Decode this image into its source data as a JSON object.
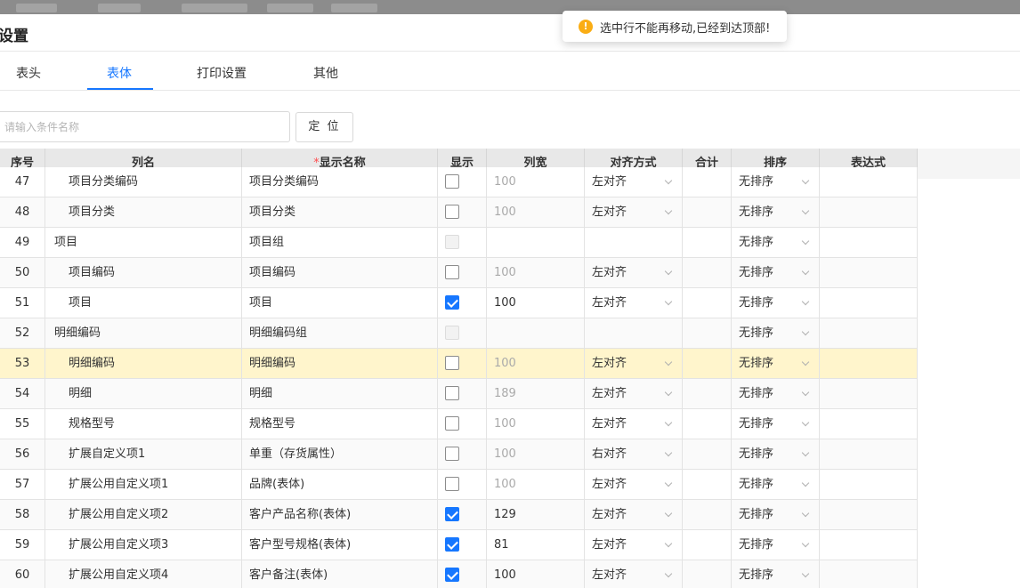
{
  "toast": {
    "icon": "warning-icon",
    "message": "选中行不能再移动,已经到达顶部!"
  },
  "dialog": {
    "title": "设置"
  },
  "tabs": [
    {
      "label": "表头",
      "active": false
    },
    {
      "label": "表体",
      "active": true
    },
    {
      "label": "打印设置",
      "active": false
    },
    {
      "label": "其他",
      "active": false
    }
  ],
  "search": {
    "placeholder": "请输入条件名称",
    "value": "",
    "locate_label": "定 位"
  },
  "table": {
    "columns": [
      "序号",
      "列名",
      "显示名称",
      "显示",
      "列宽",
      "对齐方式",
      "合计",
      "排序",
      "表达式"
    ],
    "required_mark": "*",
    "rows": [
      {
        "no": "47",
        "col": "项目分类编码",
        "indent": true,
        "display": "项目分类编码",
        "show": "off",
        "width": "100",
        "width_muted": true,
        "align": "左对齐",
        "sort": "无排序"
      },
      {
        "no": "48",
        "col": "项目分类",
        "indent": true,
        "display": "项目分类",
        "show": "off",
        "width": "100",
        "width_muted": true,
        "align": "左对齐",
        "sort": "无排序"
      },
      {
        "no": "49",
        "col": "项目",
        "indent": false,
        "display": "项目组",
        "show": "disabled",
        "width": "",
        "width_muted": false,
        "align": "",
        "sort": "无排序"
      },
      {
        "no": "50",
        "col": "项目编码",
        "indent": true,
        "display": "项目编码",
        "show": "off",
        "width": "100",
        "width_muted": true,
        "align": "左对齐",
        "sort": "无排序"
      },
      {
        "no": "51",
        "col": "项目",
        "indent": true,
        "display": "项目",
        "show": "on",
        "width": "100",
        "width_muted": false,
        "align": "左对齐",
        "sort": "无排序"
      },
      {
        "no": "52",
        "col": "明细编码",
        "indent": false,
        "display": "明细编码组",
        "show": "disabled",
        "width": "",
        "width_muted": false,
        "align": "",
        "sort": "无排序"
      },
      {
        "no": "53",
        "col": "明细编码",
        "indent": true,
        "display": "明细编码",
        "show": "off",
        "width": "100",
        "width_muted": true,
        "align": "左对齐",
        "sort": "无排序",
        "selected": true
      },
      {
        "no": "54",
        "col": "明细",
        "indent": true,
        "display": "明细",
        "show": "off",
        "width": "189",
        "width_muted": true,
        "align": "左对齐",
        "sort": "无排序"
      },
      {
        "no": "55",
        "col": "规格型号",
        "indent": true,
        "display": "规格型号",
        "show": "off",
        "width": "100",
        "width_muted": true,
        "align": "左对齐",
        "sort": "无排序"
      },
      {
        "no": "56",
        "col": "扩展自定义项1",
        "indent": true,
        "display": "单重（存货属性）",
        "show": "off",
        "width": "100",
        "width_muted": true,
        "align": "右对齐",
        "sort": "无排序"
      },
      {
        "no": "57",
        "col": "扩展公用自定义项1",
        "indent": true,
        "display": "品牌(表体)",
        "show": "off",
        "width": "100",
        "width_muted": true,
        "align": "左对齐",
        "sort": "无排序"
      },
      {
        "no": "58",
        "col": "扩展公用自定义项2",
        "indent": true,
        "display": "客户产品名称(表体)",
        "show": "on",
        "width": "129",
        "width_muted": false,
        "align": "左对齐",
        "sort": "无排序"
      },
      {
        "no": "59",
        "col": "扩展公用自定义项3",
        "indent": true,
        "display": "客户型号规格(表体)",
        "show": "on",
        "width": "81",
        "width_muted": false,
        "align": "左对齐",
        "sort": "无排序"
      },
      {
        "no": "60",
        "col": "扩展公用自定义项4",
        "indent": true,
        "display": "客户备注(表体)",
        "show": "on",
        "width": "100",
        "width_muted": false,
        "align": "左对齐",
        "sort": "无排序"
      }
    ]
  }
}
